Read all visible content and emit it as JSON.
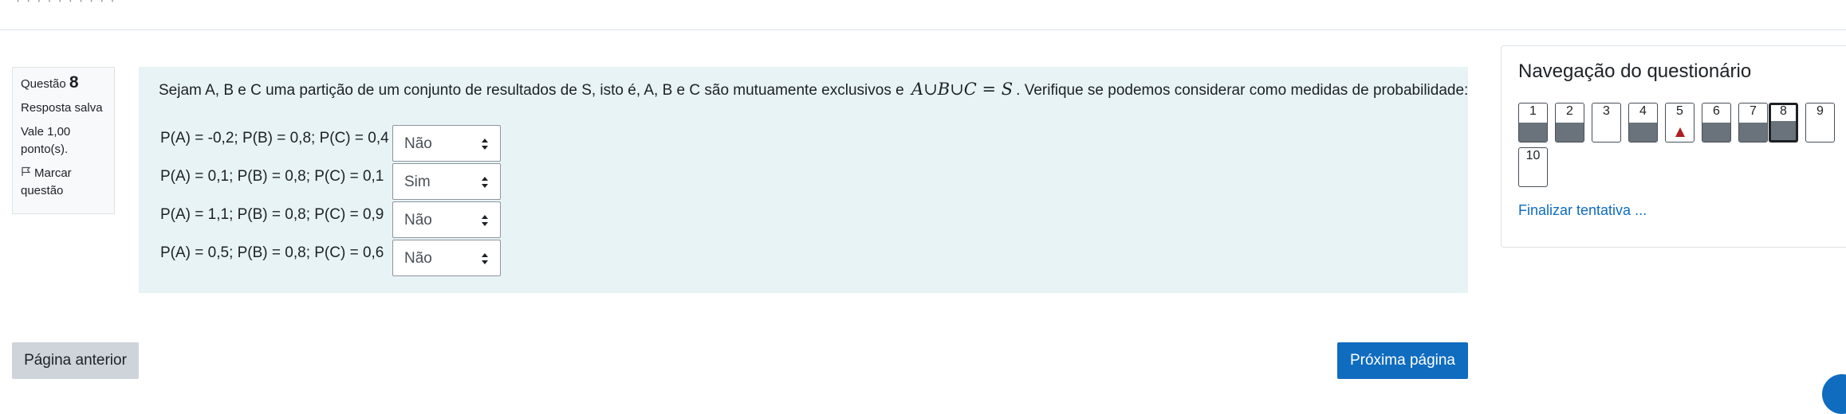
{
  "header": {
    "crumbs": "· · · · · · · · · ·"
  },
  "question_info": {
    "label": "Questão",
    "number": "8",
    "state": "Resposta salva",
    "grade_line1": "Vale 1,00",
    "grade_line2": "ponto(s).",
    "flag_line1": "Marcar",
    "flag_line2": "questão"
  },
  "question": {
    "text_before": "Sejam A, B e C uma partição de um conjunto de resultados de S, isto é, A, B e C são mutuamente exclusivos e",
    "math": "A∪B∪C = S",
    "text_after": ". Verifique se podemos considerar como medidas de probabilidade:",
    "rows": [
      {
        "label": "P(A) = -0,2; P(B) = 0,8; P(C) = 0,4",
        "selected": "Não"
      },
      {
        "label": "P(A) = 0,1; P(B) = 0,8; P(C) = 0,1",
        "selected": "Sim"
      },
      {
        "label": "P(A) = 1,1; P(B) = 0,8; P(C) = 0,9",
        "selected": "Não"
      },
      {
        "label": "P(A) = 0,5; P(B) = 0,8; P(C) = 0,6",
        "selected": "Não"
      }
    ]
  },
  "navigation": {
    "title": "Navegação do questionário",
    "questions": [
      {
        "number": "1",
        "state": "answered"
      },
      {
        "number": "2",
        "state": "answered"
      },
      {
        "number": "3",
        "state": "unanswered"
      },
      {
        "number": "4",
        "state": "answered"
      },
      {
        "number": "5",
        "state": "flagged"
      },
      {
        "number": "6",
        "state": "answered"
      },
      {
        "number": "7",
        "state": "answered"
      },
      {
        "number": "8",
        "state": "current-answered"
      },
      {
        "number": "9",
        "state": "unanswered"
      },
      {
        "number": "10",
        "state": "unanswered"
      }
    ],
    "finish_link": "Finalizar tentativa ..."
  },
  "footer": {
    "prev_button": "Página anterior",
    "next_button": "Próxima página"
  },
  "colors": {
    "accent": "#0f6cbf",
    "question_bg": "#e7f3f5",
    "answered_fill": "#6a737b",
    "flag": "#b01e1e"
  }
}
